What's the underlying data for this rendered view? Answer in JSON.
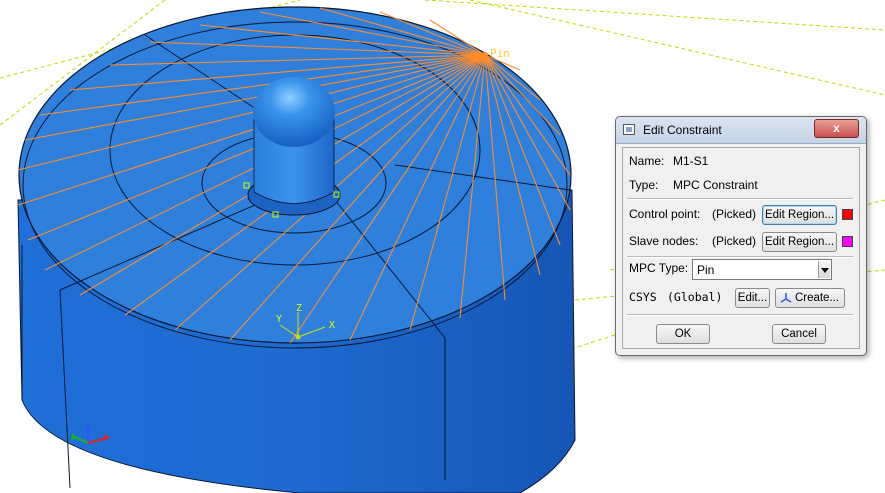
{
  "viewport": {
    "constraint_label": "Pin",
    "triad_axes": [
      "Y",
      "Z",
      "X"
    ],
    "colors": {
      "part_top": "#2f7fdc",
      "part_side": "#1b64c6",
      "spoke": "#ff8c2a",
      "edges": "#0a1830",
      "datum": "#b7e000"
    }
  },
  "dialog": {
    "title": "Edit Constraint",
    "close_label": "x",
    "name_label": "Name:",
    "name_value": "M1-S1",
    "type_label": "Type:",
    "type_value": "MPC Constraint",
    "control_point_label": "Control point:",
    "control_point_status": "(Picked)",
    "control_edit_label": "Edit Region...",
    "control_color": "#ff0000",
    "slave_nodes_label": "Slave nodes:",
    "slave_nodes_status": "(Picked)",
    "slave_edit_label": "Edit Region...",
    "slave_color": "#ff00ff",
    "mpc_type_label": "MPC Type:",
    "mpc_type_value": "Pin",
    "csys_label": "CSYS",
    "csys_value": "(Global)",
    "csys_edit_label": "Edit...",
    "csys_create_label": "Create...",
    "ok_label": "OK",
    "cancel_label": "Cancel"
  }
}
